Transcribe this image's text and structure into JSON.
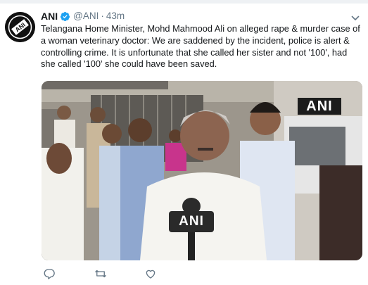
{
  "tweet": {
    "author": {
      "name": "ANI",
      "handle": "@ANI",
      "verified": true,
      "avatar_icon": "ani-logo-avatar"
    },
    "separator": "·",
    "time": "43m",
    "text": "Telangana Home Minister, Mohd Mahmood Ali on alleged rape & murder case of a woman veterinary doctor: We are saddened by the incident, police is alert & controlling crime. It is unfortunate that she called her sister and not '100', had she called '100' she could have been saved.",
    "media": {
      "watermark": "ANI",
      "mic_label": "ANI"
    },
    "actions": {
      "reply_icon": "reply-icon",
      "retweet_icon": "retweet-icon",
      "like_icon": "heart-icon"
    }
  },
  "colors": {
    "text": "#14171a",
    "secondary": "#657786",
    "verified": "#1da1f2",
    "divider": "#eef1f4"
  }
}
